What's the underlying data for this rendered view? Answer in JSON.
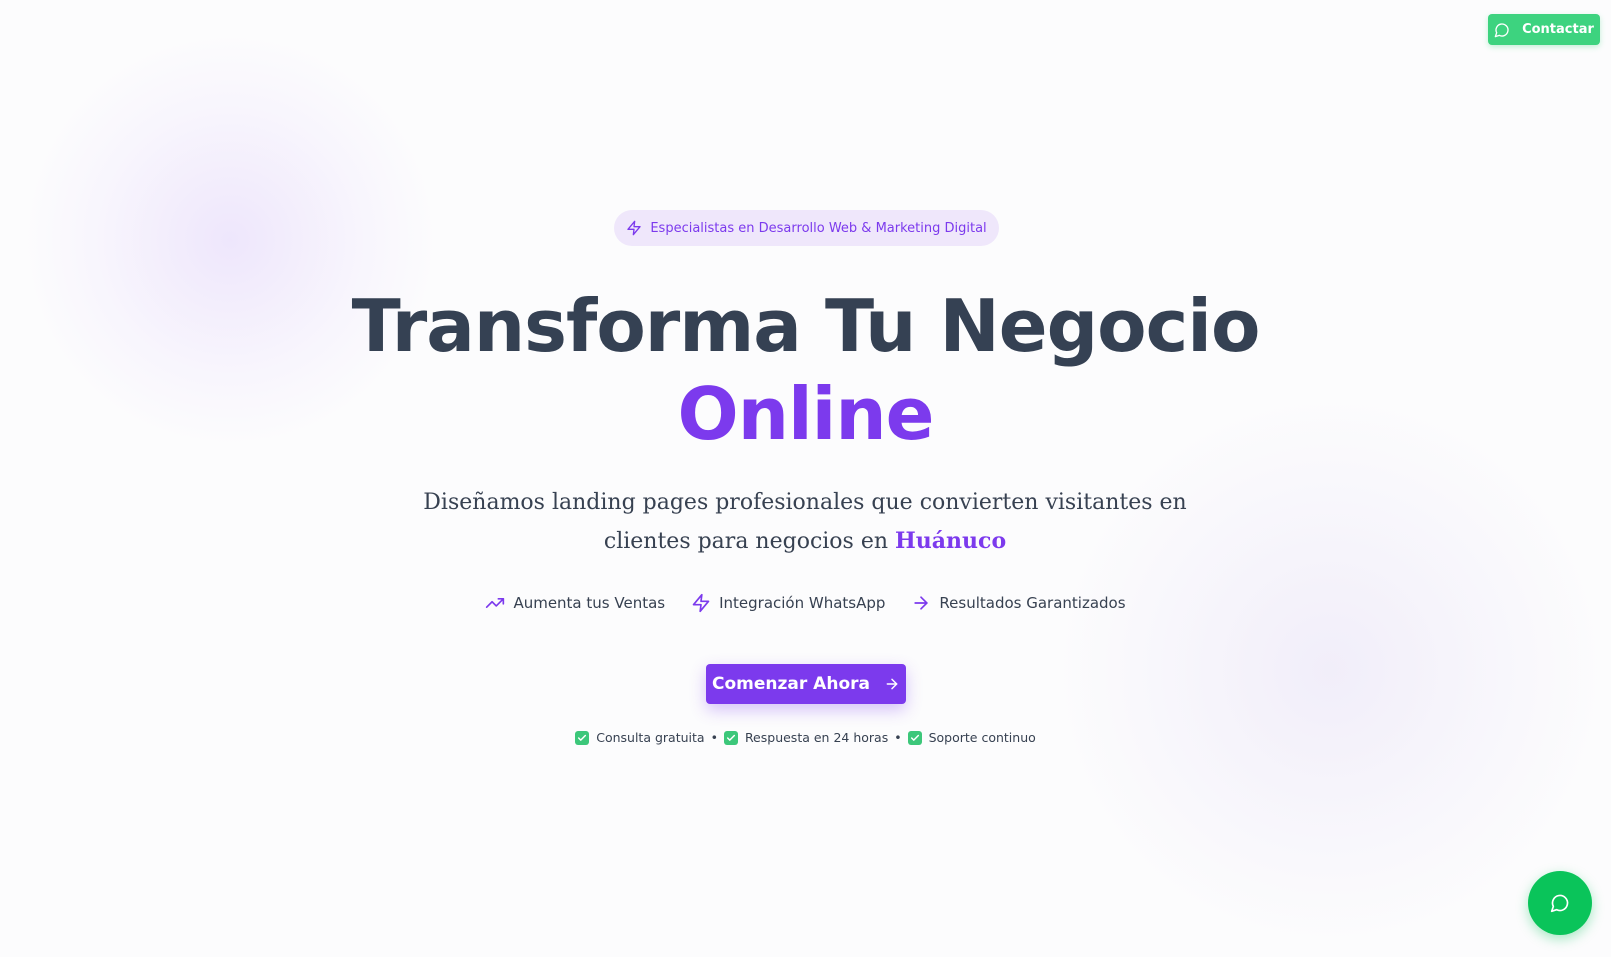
{
  "header": {
    "contact_label": "Contactar",
    "contact_icon": "message-circle-icon"
  },
  "hero": {
    "badge_icon": "lightning-icon",
    "badge_text": "Especialistas en Desarrollo Web & Marketing Digital",
    "title_line1": "Transforma Tu Negocio",
    "title_line2": "Online",
    "subtitle_before": "Diseñamos landing pages profesionales que convierten visitantes en clientes para negocios en ",
    "subtitle_highlight": "Huánuco",
    "features": [
      {
        "icon": "trending-up-icon",
        "label": "Aumenta tus Ventas"
      },
      {
        "icon": "lightning-icon",
        "label": "Integración WhatsApp"
      },
      {
        "icon": "arrow-right-icon",
        "label": "Resultados Garantizados"
      }
    ],
    "cta_label": "Comenzar Ahora",
    "perks": [
      "Consulta gratuita",
      "Respuesta en 24 horas",
      "Soporte continuo"
    ],
    "perk_separator": "•"
  },
  "colors": {
    "brand_purple": "#7c3aed",
    "whatsapp_green": "#3dd37f",
    "float_green": "#0ac45a",
    "heading": "#354153"
  }
}
